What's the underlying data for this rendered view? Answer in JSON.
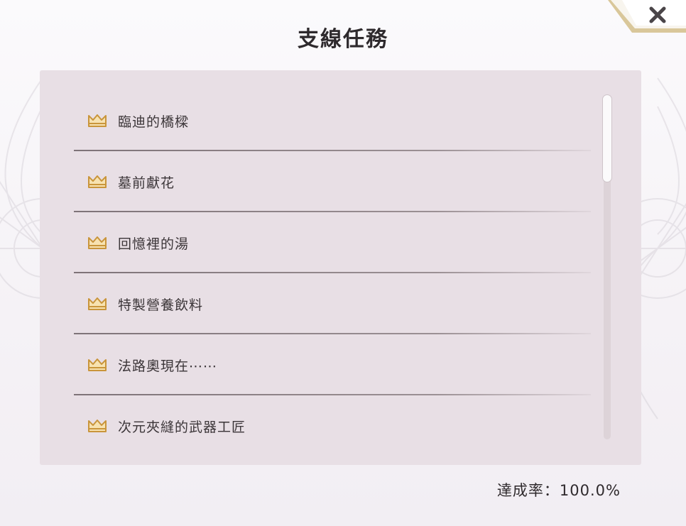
{
  "dialog": {
    "title": "支線任務",
    "close_icon": "close-x-icon"
  },
  "quests": {
    "icon": "crown-icon",
    "items": [
      {
        "label": "臨迪的橋樑"
      },
      {
        "label": "墓前獻花"
      },
      {
        "label": "回憶裡的湯"
      },
      {
        "label": "特製營養飲料"
      },
      {
        "label": "法路奧現在⋯⋯"
      },
      {
        "label": "次元夾縫的武器工匠"
      }
    ]
  },
  "footer": {
    "completion": "達成率：100.0%"
  },
  "colors": {
    "panel_bg": "#e8dfe5",
    "crown_gold": "#c9953b",
    "title_text": "#2e2a2d"
  }
}
